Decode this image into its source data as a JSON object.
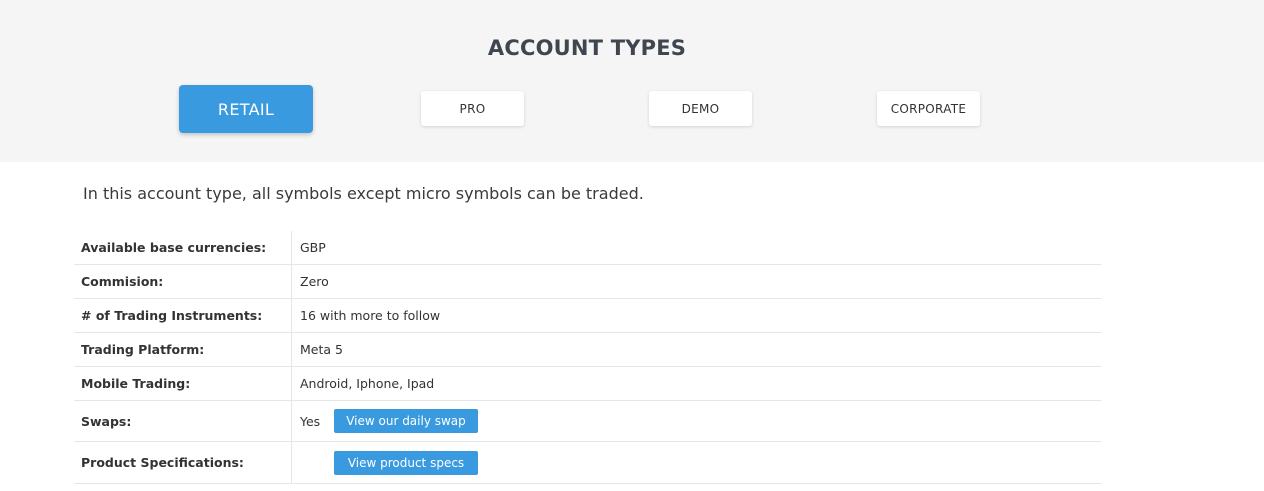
{
  "header": {
    "title": "ACCOUNT TYPES"
  },
  "tabs": [
    {
      "label": "RETAIL",
      "active": true
    },
    {
      "label": "PRO",
      "active": false
    },
    {
      "label": "DEMO",
      "active": false
    },
    {
      "label": "CORPORATE",
      "active": false
    }
  ],
  "description": "In this account type, all symbols except micro symbols can be traded.",
  "specs": [
    {
      "label": "Available base currencies:",
      "value": "GBP"
    },
    {
      "label": "Commision:",
      "value": "Zero"
    },
    {
      "label": "# of Trading Instruments:",
      "value": "16 with more to follow"
    },
    {
      "label": "Trading Platform:",
      "value": "Meta 5"
    },
    {
      "label": "Mobile Trading:",
      "value": "Android, Iphone, Ipad"
    },
    {
      "label": "Swaps:",
      "value": "Yes",
      "button": "View our daily swap"
    },
    {
      "label": "Product Specifications:",
      "value": "",
      "button": "View product specs"
    }
  ],
  "colors": {
    "accent": "#3a9ae0",
    "header_bg": "#f5f5f5",
    "title": "#3f4650"
  }
}
